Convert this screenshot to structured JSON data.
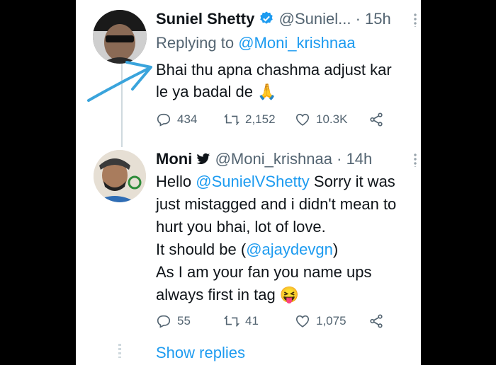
{
  "tweet1": {
    "name": "Suniel Shetty",
    "handle": "@Suniel...",
    "time": "· 15h",
    "reply_prefix": "Replying to ",
    "reply_handle": "@Moni_krishnaa",
    "line1": "Bhai thu apna chashma adjust kar",
    "line2": "le ya badal de 🙏",
    "replies": "434",
    "retweets": "2,152",
    "likes": "10.3K"
  },
  "tweet2": {
    "name": "Moni",
    "handle": "@Moni_krishnaa",
    "time": "· 14h",
    "line1_prefix": "Hello ",
    "line1_mention": "@SunielVShetty",
    "line1_suffix": " Sorry it was",
    "line2": "just mistagged and i didn't mean to",
    "line3": "hurt you bhai, lot of love.",
    "line4_prefix": "It should be (",
    "line4_mention": "@ajaydevgn",
    "line4_suffix": ")",
    "line5": "As I am your fan you name ups",
    "line6": "always first in tag 😝",
    "replies": "55",
    "retweets": "41",
    "likes": "1,075"
  },
  "show_replies": "Show replies",
  "colors": {
    "accent": "#1d9bf0",
    "text": "#0f1419",
    "muted": "#536471",
    "arrow": "#3aa4dc"
  },
  "icons": [
    "verified-badge-icon",
    "twitter-bird-icon",
    "reply-icon",
    "retweet-icon",
    "like-icon",
    "share-icon",
    "more-icon"
  ]
}
